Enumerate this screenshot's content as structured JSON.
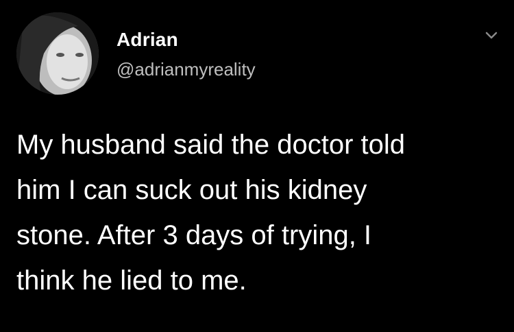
{
  "tweet": {
    "author_name": "Adrian",
    "author_handle": "@adrianmyreality",
    "text": "My husband said the doctor told\nhim I can suck out his kidney\nstone. After 3 days of trying, I\nthink he lied to me.",
    "avatar_icon": "profile-photo",
    "menu_icon": "chevron-down-icon"
  },
  "colors": {
    "background": "#000000",
    "text": "#ffffff",
    "handle": "#bfbfbf",
    "chevron": "#8a8a8a"
  }
}
